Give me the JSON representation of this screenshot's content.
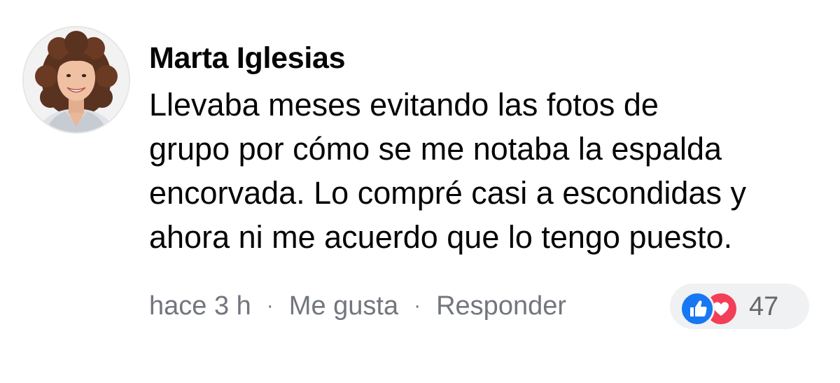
{
  "comment": {
    "author": "Marta Iglesias",
    "body_lines": [
      "Llevaba meses evitando las fotos de",
      "grupo por cómo se me notaba la espalda",
      "encorvada. Lo compré casi a escondidas y",
      "ahora ni me acuerdo que lo tengo puesto."
    ],
    "timestamp": "hace 3 h",
    "separator": "·",
    "like_label": "Me gusta",
    "reply_label": "Responder",
    "reactions": {
      "icons": [
        "like-icon",
        "love-icon"
      ],
      "count": "47",
      "colors": {
        "like": "#1877f2",
        "love": "#f33e58"
      }
    }
  }
}
